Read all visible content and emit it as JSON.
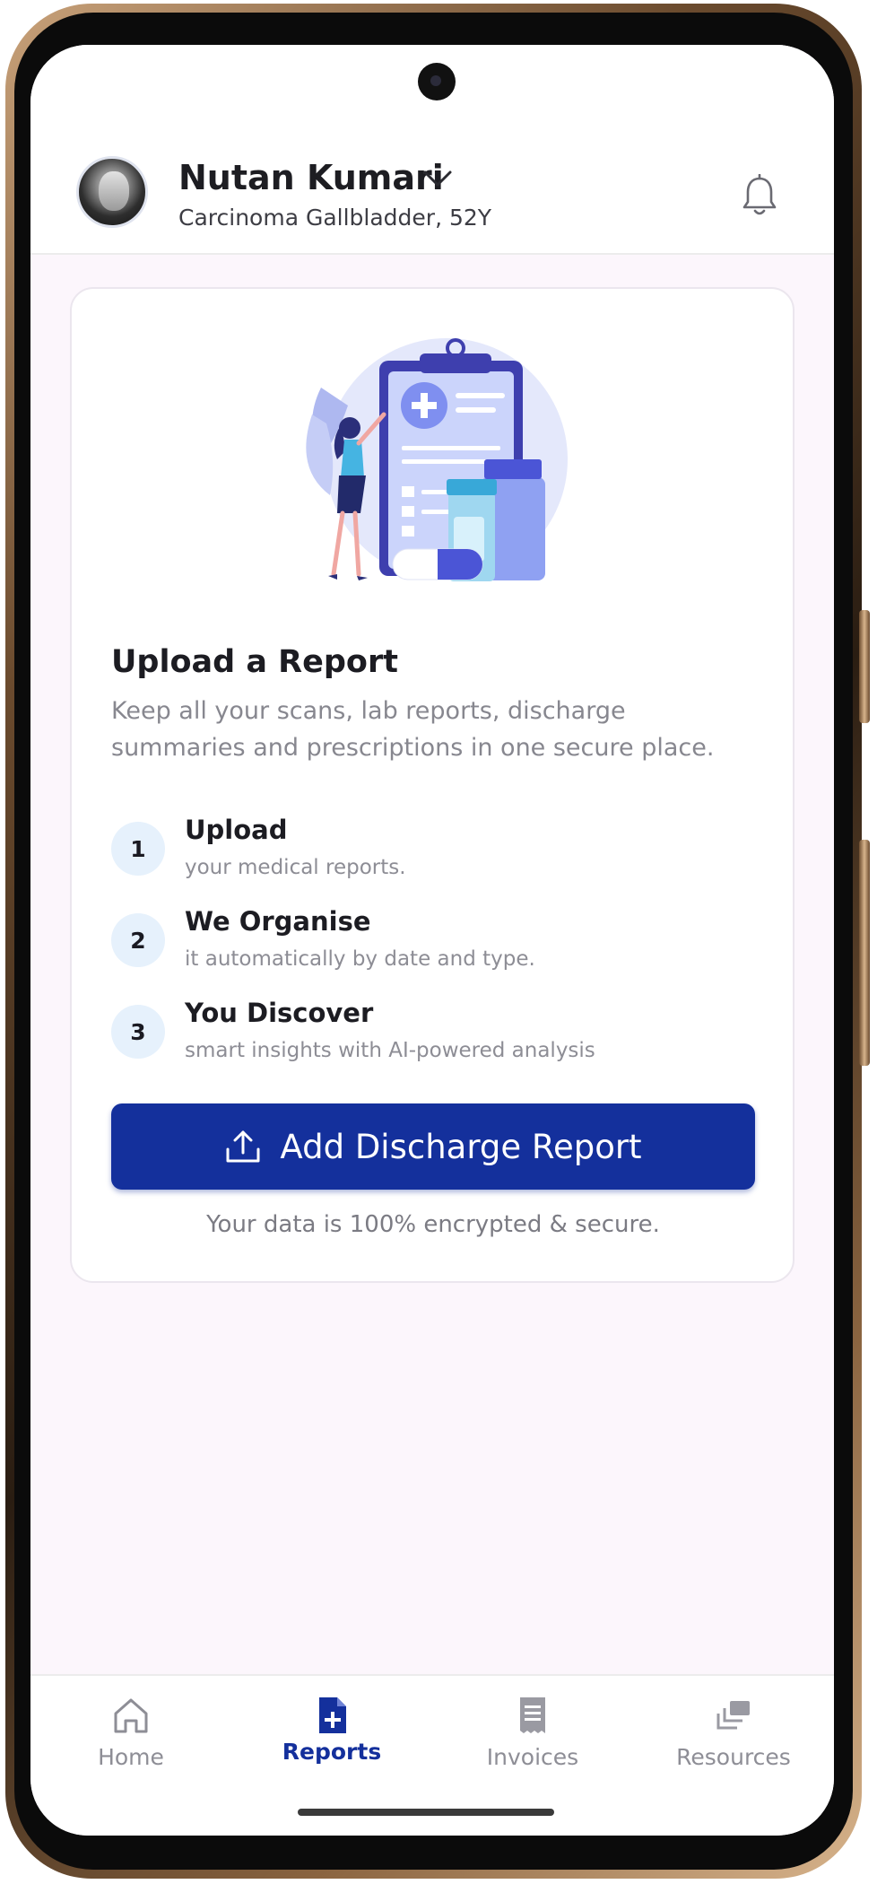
{
  "header": {
    "user_name": "Nutan Kumari",
    "user_subtitle": "Carcinoma Gallbladder, 52Y",
    "icons": [
      "avatar",
      "chevron-down-icon",
      "bell-icon"
    ]
  },
  "card": {
    "title": "Upload a Report",
    "description": "Keep all your scans, lab reports, discharge summaries and prescriptions in one secure place.",
    "steps": [
      {
        "number": "1",
        "title": "Upload",
        "subtitle": "your medical reports."
      },
      {
        "number": "2",
        "title": "We Organise",
        "subtitle": "it automatically by date and type."
      },
      {
        "number": "3",
        "title": "You Discover",
        "subtitle": "smart insights with AI-powered analysis"
      }
    ],
    "cta_label": "Add Discharge Report",
    "cta_icon": "upload-icon",
    "security_note": "Your data is 100% encrypted & secure."
  },
  "nav": {
    "items": [
      {
        "label": "Home",
        "icon": "home-icon",
        "active": false
      },
      {
        "label": "Reports",
        "icon": "report-plus-icon",
        "active": true
      },
      {
        "label": "Invoices",
        "icon": "invoice-icon",
        "active": false
      },
      {
        "label": "Resources",
        "icon": "resources-icon",
        "active": false
      }
    ]
  },
  "colors": {
    "primary": "#14309c",
    "background": "#fcf6fc",
    "step_badge": "#e6f1fc",
    "muted_text": "#87878f"
  }
}
